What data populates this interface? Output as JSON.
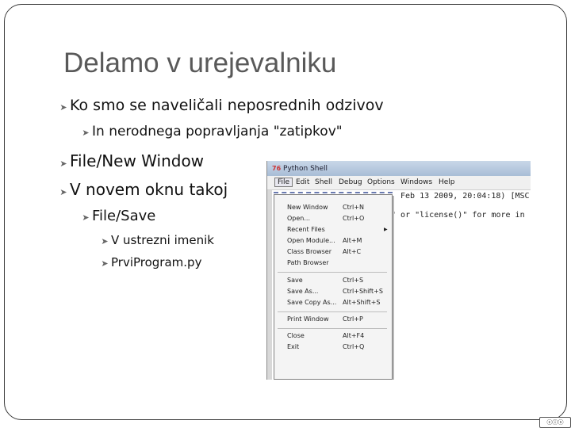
{
  "slide": {
    "title": "Delamo v urejevalniku",
    "bullets": [
      {
        "text": "Ko smo se naveličali neposrednih odzivov",
        "level": 1
      },
      {
        "text": "In nerodnega popravljanja \"zatipkov\"",
        "level": 2
      },
      {
        "text": "File/New Window",
        "level": 1
      },
      {
        "text": "V novem oknu takoj",
        "level": 1
      },
      {
        "text": "File/Save",
        "level": 2
      },
      {
        "text": "V ustrezni imenik",
        "level": 3
      },
      {
        "text": "PrviProgram.py",
        "level": 3
      }
    ],
    "bullet_marker": "arrow-bullet-icon",
    "license_badge": "cc-by-sa-icon"
  },
  "screenshot": {
    "window_title": "Python Shell",
    "menus": [
      "File",
      "Edit",
      "Shell",
      "Debug",
      "Options",
      "Windows",
      "Help"
    ],
    "active_menu": "File",
    "shell_lines": [
      "Feb 13 2009, 20:04:18) [MSC",
      "s\" or \"license()\" for more in"
    ],
    "file_menu": [
      {
        "label": "New Window",
        "shortcut": "Ctrl+N"
      },
      {
        "label": "Open...",
        "shortcut": "Ctrl+O"
      },
      {
        "label": "Recent Files",
        "shortcut": "",
        "submenu": true
      },
      {
        "label": "Open Module...",
        "shortcut": "Alt+M"
      },
      {
        "label": "Class Browser",
        "shortcut": "Alt+C"
      },
      {
        "label": "Path Browser",
        "shortcut": ""
      },
      {
        "label": "Save",
        "shortcut": "Ctrl+S"
      },
      {
        "label": "Save As...",
        "shortcut": "Ctrl+Shift+S"
      },
      {
        "label": "Save Copy As...",
        "shortcut": "Alt+Shift+S"
      },
      {
        "label": "Print Window",
        "shortcut": "Ctrl+P"
      },
      {
        "label": "Close",
        "shortcut": "Alt+F4"
      },
      {
        "label": "Exit",
        "shortcut": "Ctrl+Q"
      }
    ]
  },
  "colors": {
    "title": "#595959",
    "frame": "#3a3a3a",
    "titlebar": "#b8cade"
  }
}
